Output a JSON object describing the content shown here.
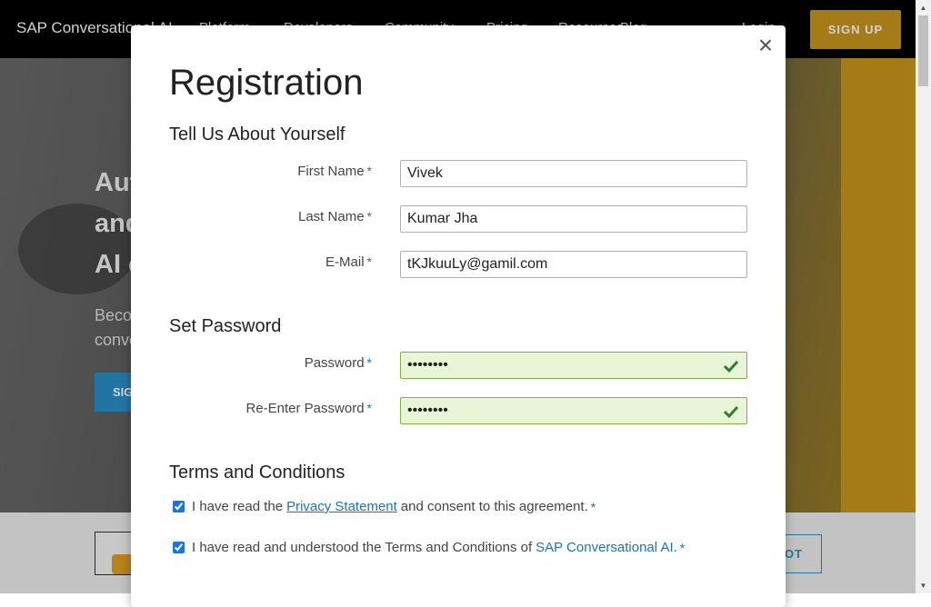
{
  "background": {
    "brand": "SAP Conversational AI",
    "nav": [
      "Platform",
      "Developers",
      "Community",
      "Pricing",
      "Resources",
      "Blog",
      "Login"
    ],
    "signup_top": "SIGN UP",
    "hero_title": "Aut\nand\nAI c",
    "hero_sub": "Beco\nconve",
    "hero_button": "SIG",
    "lower_button": "OT"
  },
  "modal": {
    "title": "Registration",
    "close_label": "×",
    "section_about": "Tell Us About Yourself",
    "first_name_label": "First Name",
    "first_name_value": "Vivek",
    "last_name_label": "Last Name",
    "last_name_value": "Kumar Jha",
    "email_label": "E-Mail",
    "email_value": "tKJkuuLy@gamil.com",
    "section_password": "Set Password",
    "password_label": "Password",
    "password_value": "••••••••",
    "reenter_label": "Re-Enter Password",
    "reenter_value": "••••••••",
    "required_mark": "*",
    "section_terms": "Terms and Conditions",
    "privacy_text_before": "I have read the",
    "privacy_link": "Privacy Statement",
    "privacy_text_after": "and consent to this agreement.",
    "terms_text": "I have read and understood the Terms and Conditions of",
    "terms_link": "SAP Conversational AI."
  },
  "icons": {
    "close": "close-icon",
    "check": "checkmark-icon"
  },
  "colors": {
    "accent": "#c8971d",
    "link": "#1a73c0",
    "valid_bg": "#e8f5d6",
    "check": "#2e7d32"
  }
}
